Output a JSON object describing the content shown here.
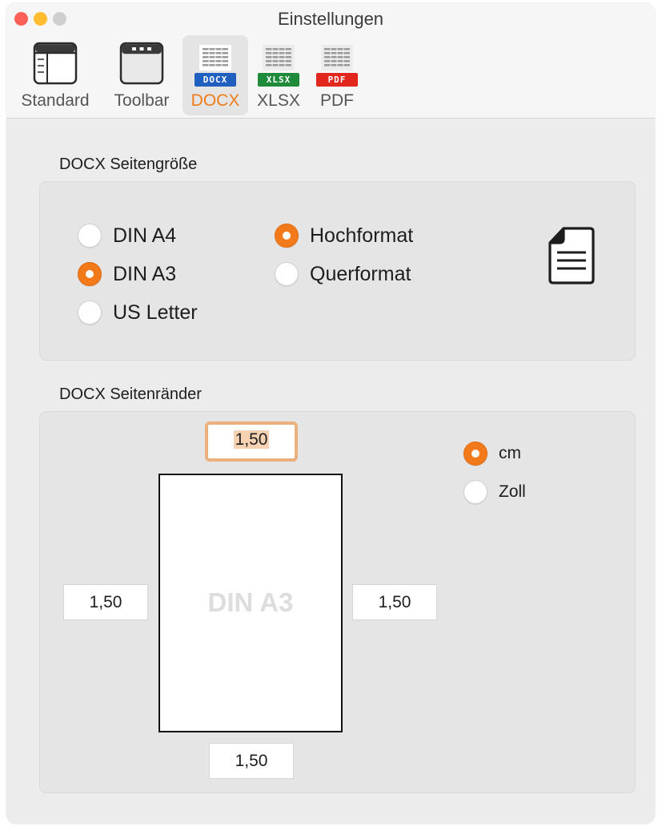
{
  "window": {
    "title": "Einstellungen"
  },
  "colors": {
    "accent": "#f37a1a",
    "traffic_close": "#fe5f57",
    "traffic_minimize": "#febc2e",
    "traffic_zoom": "#cfcfcf",
    "docx_badge": "#1f5fbf",
    "xlsx_badge": "#1e8b3a",
    "pdf_badge": "#e0261d"
  },
  "toolbar": {
    "tabs": [
      {
        "label": "Standard",
        "icon": "window-sidebar-icon",
        "active": false
      },
      {
        "label": "Toolbar",
        "icon": "window-toolbar-icon",
        "active": false
      },
      {
        "label": "DOCX",
        "icon": "docx-file-icon",
        "badge": "DOCX",
        "active": true
      },
      {
        "label": "XLSX",
        "icon": "xlsx-file-icon",
        "badge": "XLSX",
        "active": false
      },
      {
        "label": "PDF",
        "icon": "pdf-file-icon",
        "badge": "PDF",
        "active": false
      }
    ]
  },
  "page_size": {
    "title": "DOCX Seitengröße",
    "sizes": [
      {
        "label": "DIN A4",
        "selected": false
      },
      {
        "label": "DIN A3",
        "selected": true
      },
      {
        "label": "US Letter",
        "selected": false
      }
    ],
    "orientations": [
      {
        "label": "Hochformat",
        "selected": true
      },
      {
        "label": "Querformat",
        "selected": false
      }
    ],
    "orientation_icon": "document-portrait-icon"
  },
  "margins": {
    "title": "DOCX Seitenränder",
    "top": "1,50",
    "left": "1,50",
    "right": "1,50",
    "bottom": "1,50",
    "focused_field": "top",
    "page_label": "DIN A3",
    "units": [
      {
        "label": "cm",
        "selected": true
      },
      {
        "label": "Zoll",
        "selected": false
      }
    ]
  }
}
